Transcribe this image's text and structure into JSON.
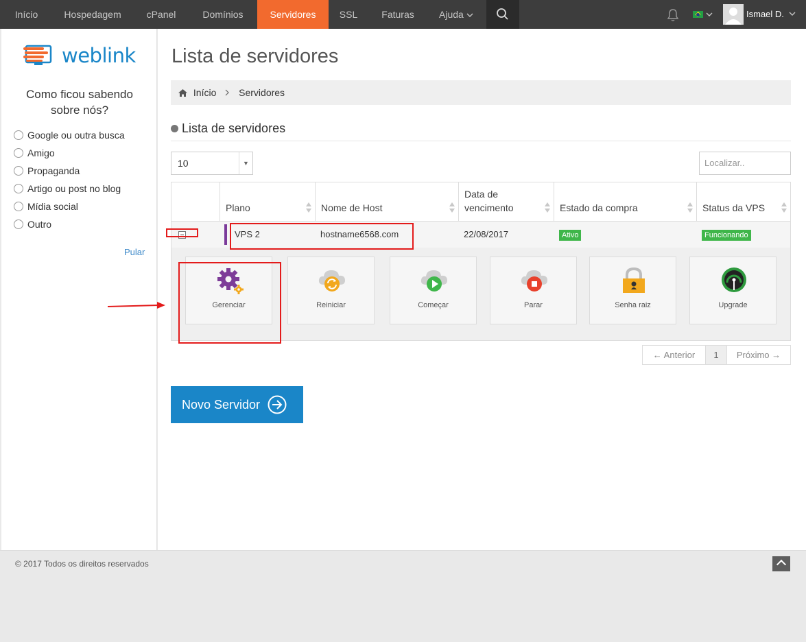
{
  "nav": {
    "items": [
      {
        "label": "Início"
      },
      {
        "label": "Hospedagem"
      },
      {
        "label": "cPanel"
      },
      {
        "label": "Domínios"
      },
      {
        "label": "Servidores",
        "active": true
      },
      {
        "label": "SSL"
      },
      {
        "label": "Faturas"
      },
      {
        "label": "Ajuda"
      }
    ],
    "user_name": "Ismael D.",
    "active_color": "#f26a2e"
  },
  "sidebar": {
    "brand": "weblink",
    "survey_title": "Como ficou sabendo sobre nós?",
    "options": [
      "Google ou outra busca",
      "Amigo",
      "Propaganda",
      "Artigo ou post no blog",
      "Mídia social",
      "Outro"
    ],
    "skip_label": "Pular"
  },
  "main": {
    "title": "Lista de servidores",
    "breadcrumb": [
      "Início",
      "Servidores"
    ],
    "section_title": "Lista de servidores",
    "page_size": "10",
    "search_placeholder": "Localizar..",
    "columns": [
      "Plano",
      "Nome de Host",
      "Data de vencimento",
      "Estado da compra",
      "Status da VPS"
    ],
    "row": {
      "plan": "VPS 2",
      "host": "hostname6568.com",
      "expiry": "22/08/2017",
      "purchase_state": "Ativo",
      "vps_status": "Funcionando"
    },
    "actions": [
      {
        "label": "Gerenciar",
        "icon": "gear-icon"
      },
      {
        "label": "Reiniciar",
        "icon": "restart-cloud-icon"
      },
      {
        "label": "Começar",
        "icon": "play-cloud-icon"
      },
      {
        "label": "Parar",
        "icon": "stop-cloud-icon"
      },
      {
        "label": "Senha raiz",
        "icon": "padlock-icon"
      },
      {
        "label": "Upgrade",
        "icon": "gauge-icon"
      }
    ],
    "pager": {
      "prev": "← Anterior",
      "current": "1",
      "next": "Próximo →"
    },
    "new_server_label": "Novo Servidor"
  },
  "footer": {
    "copyright": "© 2017 Todos os direitos reservados"
  }
}
